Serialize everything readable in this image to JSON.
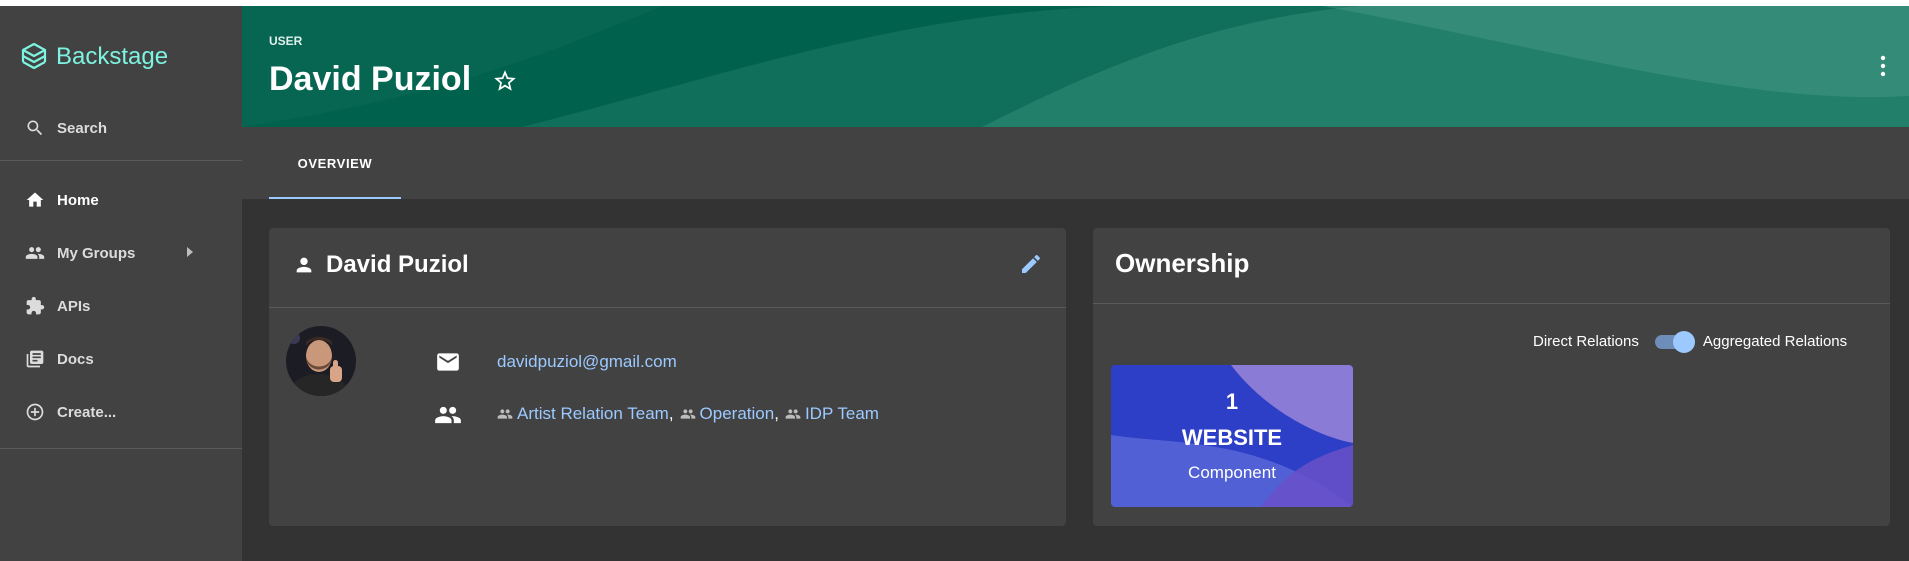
{
  "app": {
    "name": "Backstage",
    "logo_color": "#7df3e1"
  },
  "sidebar": {
    "search_label": "Search",
    "items": [
      {
        "label": "Home",
        "icon": "home-icon",
        "active": true
      },
      {
        "label": "My Groups",
        "icon": "group-icon",
        "expandable": true
      },
      {
        "label": "APIs",
        "icon": "puzzle-icon"
      },
      {
        "label": "Docs",
        "icon": "library-icon"
      },
      {
        "label": "Create...",
        "icon": "add-circle-icon"
      }
    ]
  },
  "header": {
    "subtitle": "USER",
    "title": "David Puziol",
    "background": "#00624d"
  },
  "tabs": [
    {
      "label": "OVERVIEW",
      "active": true
    }
  ],
  "profile": {
    "name": "David Puziol",
    "email": "davidpuziol@gmail.com",
    "groups": [
      "Artist Relation Team",
      "Operation",
      "IDP Team"
    ],
    "link_color": "#9cc9ff"
  },
  "ownership": {
    "title": "Ownership",
    "toggle_left": "Direct Relations",
    "toggle_right": "Aggregated Relations",
    "toggle_on": true,
    "tiles": [
      {
        "count": "1",
        "kind": "WEBSITE",
        "type": "Component"
      }
    ]
  }
}
